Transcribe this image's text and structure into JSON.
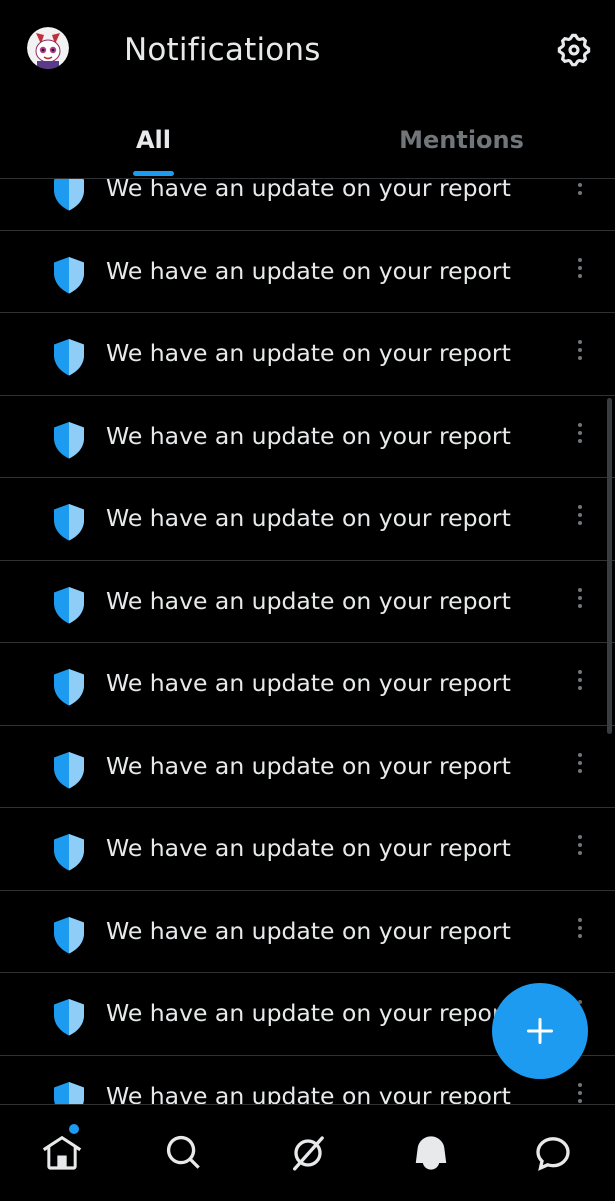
{
  "header": {
    "title": "Notifications",
    "avatar_icon": "user-avatar",
    "settings_icon": "gear-icon"
  },
  "tabs": [
    {
      "label": "All",
      "active": true
    },
    {
      "label": "Mentions",
      "active": false
    }
  ],
  "notifications": [
    {
      "icon": "shield-icon",
      "text": "We have an update on your report"
    },
    {
      "icon": "shield-icon",
      "text": "We have an update on your report"
    },
    {
      "icon": "shield-icon",
      "text": "We have an update on your report"
    },
    {
      "icon": "shield-icon",
      "text": "We have an update on your report"
    },
    {
      "icon": "shield-icon",
      "text": "We have an update on your report"
    },
    {
      "icon": "shield-icon",
      "text": "We have an update on your report"
    },
    {
      "icon": "shield-icon",
      "text": "We have an update on your report"
    },
    {
      "icon": "shield-icon",
      "text": "We have an update on your report"
    },
    {
      "icon": "shield-icon",
      "text": "We have an update on your report"
    },
    {
      "icon": "shield-icon",
      "text": "We have an update on your report"
    },
    {
      "icon": "shield-icon",
      "text": "We have an update on your report"
    },
    {
      "icon": "shield-icon",
      "text": "We have an update on your report"
    }
  ],
  "fab": {
    "icon": "plus-icon"
  },
  "bottom_nav": [
    {
      "icon": "home-icon",
      "has_badge_dot": true
    },
    {
      "icon": "search-icon"
    },
    {
      "icon": "spaces-icon"
    },
    {
      "icon": "bell-icon",
      "active": true
    },
    {
      "icon": "messages-icon"
    }
  ],
  "colors": {
    "background": "#000000",
    "accent": "#1d9bf0",
    "text_primary": "#e7e9ea",
    "text_secondary": "#71767b",
    "divider": "#2f3336"
  }
}
